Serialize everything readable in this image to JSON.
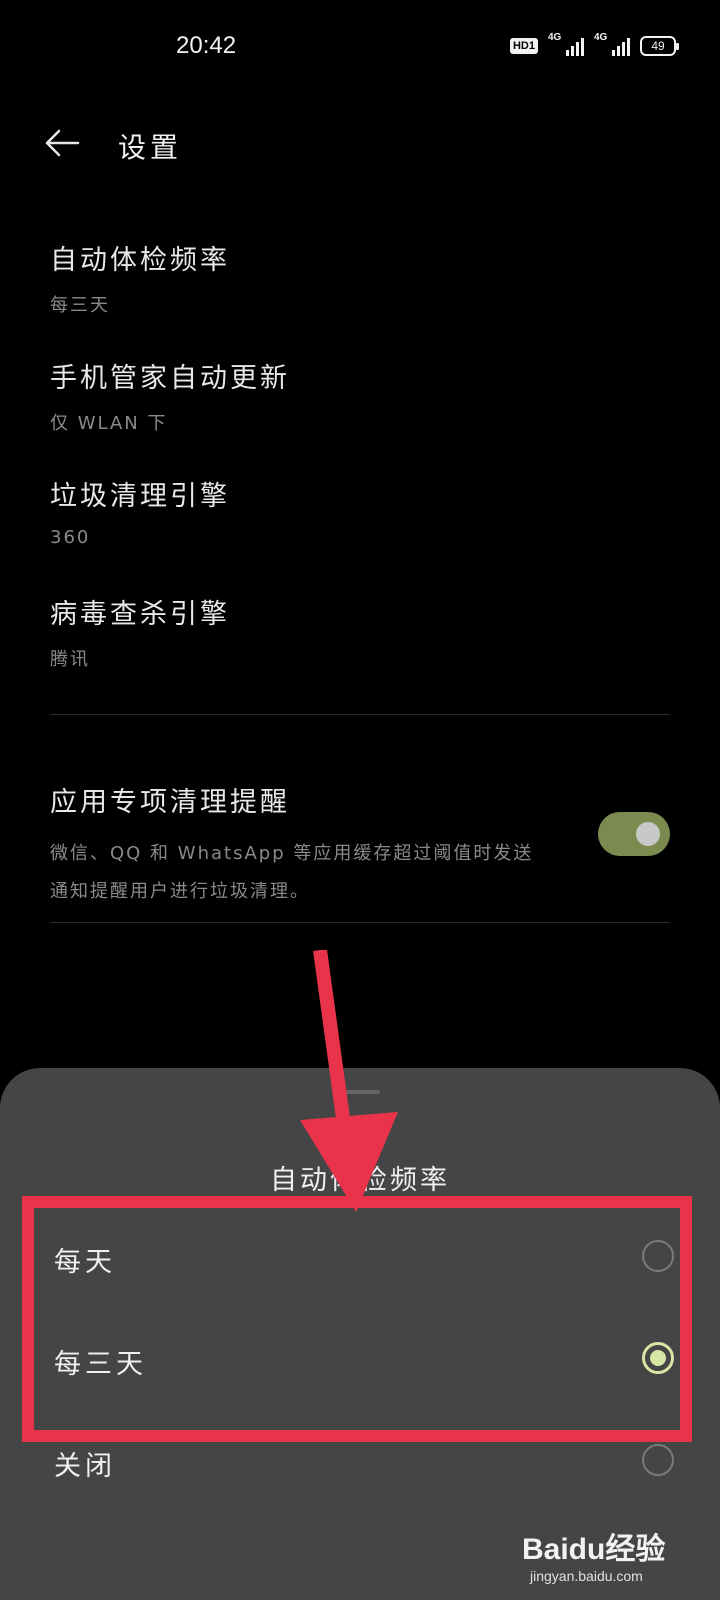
{
  "status_bar": {
    "time": "20:42",
    "hd_badge": "HD1",
    "network_1": "4G",
    "network_2": "4G",
    "battery": "49"
  },
  "header": {
    "title": "设置",
    "back_icon": "arrow-left-icon"
  },
  "settings": [
    {
      "title": "自动体检频率",
      "subtitle": "每三天"
    },
    {
      "title": "手机管家自动更新",
      "subtitle": "仅 WLAN 下"
    },
    {
      "title": "垃圾清理引擎",
      "subtitle": "360"
    },
    {
      "title": "病毒查杀引擎",
      "subtitle": "腾讯"
    }
  ],
  "toggle_setting": {
    "title": "应用专项清理提醒",
    "description": "微信、QQ 和 WhatsApp 等应用缓存超过阈值时发送通知提醒用户进行垃圾清理。",
    "enabled": true
  },
  "sheet": {
    "title": "自动体检频率",
    "options": [
      {
        "label": "每天",
        "selected": false
      },
      {
        "label": "每三天",
        "selected": true
      },
      {
        "label": "关闭",
        "selected": false
      }
    ]
  },
  "annotation": {
    "highlight_color": "#e8334a"
  },
  "watermark": {
    "brand": "Baidu经验",
    "url": "jingyan.baidu.com"
  },
  "colors": {
    "accent": "#d6e6a5",
    "toggle_on": "#7b8a4f",
    "sheet_bg": "#454545"
  }
}
